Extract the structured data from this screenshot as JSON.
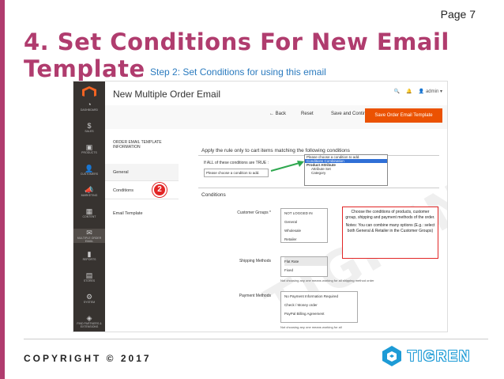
{
  "slide": {
    "page_label": "Page 7",
    "title": "4. Set Conditions For New Email Template",
    "subtitle": "Step 2: Set Conditions for using this email",
    "copyright": "COPYRIGHT © 2017",
    "brand": "TIGREN",
    "watermark": "TIGREN",
    "accent_color": "#b03c6e",
    "link_color": "#2b7bbf"
  },
  "nav": {
    "items": [
      {
        "icon": "dashboard-icon",
        "glyph": "◔",
        "label": "DASHBOARD"
      },
      {
        "icon": "sales-icon",
        "glyph": "$",
        "label": "SALES"
      },
      {
        "icon": "products-icon",
        "glyph": "▣",
        "label": "PRODUCTS"
      },
      {
        "icon": "customers-icon",
        "glyph": "👤",
        "label": "CUSTOMERS"
      },
      {
        "icon": "marketing-icon",
        "glyph": "📣",
        "label": "MARKETING"
      },
      {
        "icon": "content-icon",
        "glyph": "▦",
        "label": "CONTENT"
      },
      {
        "icon": "multiple-order-email-icon",
        "glyph": "✉",
        "label": "MULTIPLE ORDER EMAIL"
      },
      {
        "icon": "reports-icon",
        "glyph": "▮",
        "label": "REPORTS"
      },
      {
        "icon": "stores-icon",
        "glyph": "▤",
        "label": "STORES"
      },
      {
        "icon": "system-icon",
        "glyph": "⚙",
        "label": "SYSTEM"
      },
      {
        "icon": "find-partners-icon",
        "glyph": "◈",
        "label": "FIND PARTNERS & EXTENSIONS"
      }
    ]
  },
  "header": {
    "page_title": "New Multiple Order Email",
    "user": "admin ▾"
  },
  "actions": {
    "back": "← Back",
    "reset": "Reset",
    "save_continue": "Save and Continue Edit",
    "save_template": "Save Order Email Template"
  },
  "left_panel": {
    "title": "ORDER EMAIL TEMPLATE INFORMATION",
    "tabs": [
      "General",
      "Conditions"
    ],
    "badge": "2",
    "extra_link": "Email Template"
  },
  "conditions": {
    "apply_heading": "Apply the rule only to cart items matching the following conditions",
    "rule_text": "If ALL of these conditions are TRUE :",
    "select_placeholder": "Please choose a condition to add.",
    "dropdown_options": [
      {
        "text": "Please choose a condition to add.",
        "style": "normal"
      },
      {
        "text": "Conditions Combination",
        "style": "selected"
      },
      {
        "text": "Product Attribute",
        "style": "group"
      },
      {
        "text": "Attribute Set",
        "style": "sub"
      },
      {
        "text": "Category",
        "style": "sub"
      }
    ],
    "section_heading": "Conditions",
    "customer_groups_label": "Customer Groups *",
    "customer_groups": [
      "NOT LOGGED IN",
      "General",
      "Wholesale",
      "Retailer"
    ],
    "shipping_label": "Shipping Methods",
    "shipping_methods": [
      "Flat Rate",
      "Fixed"
    ],
    "shipping_note": "Not choosing any one means working for all shipping method order",
    "payment_label": "Payment Methods",
    "payment_methods": [
      "No Payment Information Required",
      "Check / Money order",
      "PayPal Billing Agreement"
    ],
    "payment_note": "Not choosing any one means working for all"
  },
  "callout": {
    "line1": "Choose the conditions of products, customer group, shipping and payment methods of the order.",
    "line2": "Notes: You can combine many options (E.g.: select both General & Retailer in the Customer Groups)"
  }
}
